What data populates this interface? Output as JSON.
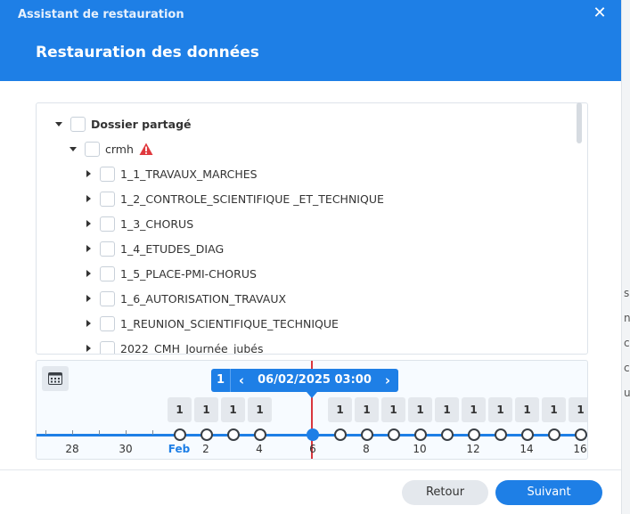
{
  "window": {
    "title": "Assistant de restauration",
    "close_glyph": "✕"
  },
  "page": {
    "title": "Restauration des données"
  },
  "tree": {
    "root": {
      "label": "Dossier partagé",
      "expanded": true
    },
    "share": {
      "label": "crmh",
      "expanded": true,
      "warning_icon": "warning-icon"
    },
    "folders": [
      {
        "label": "1_1_TRAVAUX_MARCHES"
      },
      {
        "label": "1_2_CONTROLE_SCIENTIFIQUE _ET_TECHNIQUE"
      },
      {
        "label": "1_3_CHORUS"
      },
      {
        "label": "1_4_ETUDES_DIAG"
      },
      {
        "label": "1_5_PLACE-PMI-CHORUS"
      },
      {
        "label": "1_6_AUTORISATION_TRAVAUX"
      },
      {
        "label": "1_REUNION_SCIENTIFIQUE_TECHNIQUE"
      },
      {
        "label": "2022_CMH_Journée_jubés"
      }
    ]
  },
  "timeline": {
    "selected_count": "1",
    "selected_datetime": "06/02/2025 03:00",
    "prev_glyph": "‹",
    "next_glyph": "›",
    "badges": [
      "1",
      "1",
      "1",
      "1",
      "1",
      "1",
      "1",
      "1",
      "1",
      "1",
      "1",
      "1",
      "1",
      "1",
      "1",
      "1"
    ],
    "labels": [
      "28",
      "30",
      "Feb",
      "2",
      "4",
      "6",
      "8",
      "10",
      "12",
      "14",
      "16"
    ],
    "month_label": "Feb",
    "accent_color": "#1e7fe6",
    "marker_color": "#d9363e"
  },
  "footer": {
    "back_label": "Retour",
    "next_label": "Suivant"
  }
}
